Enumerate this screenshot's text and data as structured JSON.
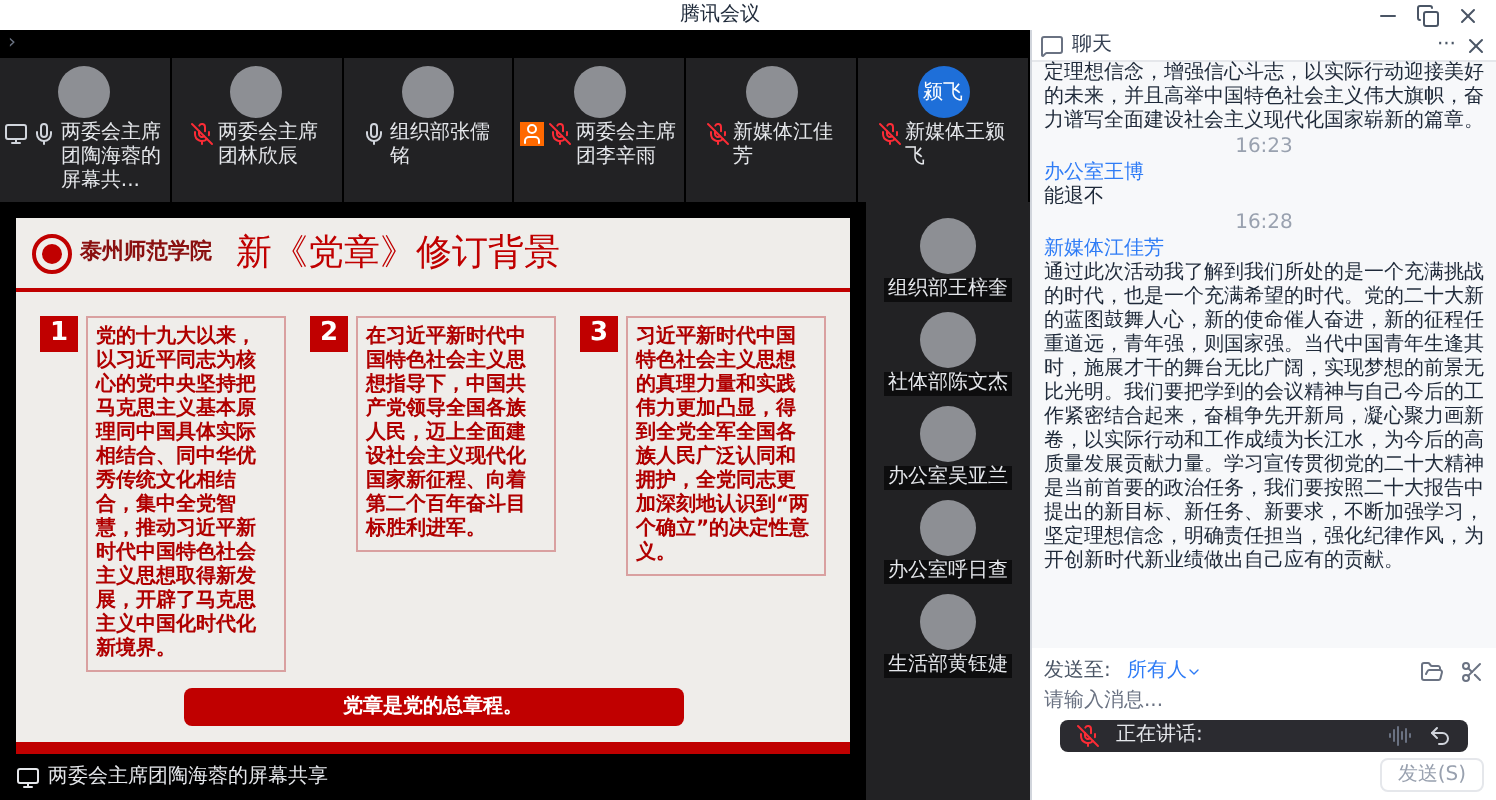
{
  "window": {
    "title": "腾讯会议"
  },
  "top_strip": {
    "toggle": "›",
    "participants": [
      {
        "name": "两委会主席团陶海蓉的屏幕共...",
        "muted": false,
        "sharing": true,
        "host": false
      },
      {
        "name": "两委会主席团林欣辰",
        "muted": true,
        "sharing": false,
        "host": false
      },
      {
        "name": "组织部张儒铭",
        "muted": false,
        "sharing": false,
        "host": false
      },
      {
        "name": "两委会主席团李辛雨",
        "muted": true,
        "sharing": false,
        "host": true
      },
      {
        "name": "新媒体江佳芳",
        "muted": true,
        "sharing": false,
        "host": false
      },
      {
        "name": "新媒体王颍飞",
        "muted": true,
        "sharing": false,
        "host": false,
        "initials": "颍飞"
      }
    ]
  },
  "slide": {
    "school": "泰州师范学院",
    "title": "新《党章》修订背景",
    "cards": [
      {
        "number": "1",
        "text": "党的十九大以来，以习近平同志为核心的党中央坚持把马克思主义基本原理同中国具体实际相结合、同中华优秀传统文化相结合，集中全党智慧，推动习近平新时代中国特色社会主义思想取得新发展，开辟了马克思主义中国化时代化新境界。"
      },
      {
        "number": "2",
        "text": "在习近平新时代中国特色社会主义思想指导下，中国共产党领导全国各族人民，迈上全面建设社会主义现代化国家新征程、向着第二个百年奋斗目标胜利进军。"
      },
      {
        "number": "3",
        "text": "习近平新时代中国特色社会主义思想的真理力量和实践伟力更加凸显，得到全党全军全国各族人民广泛认同和拥护，全党同志更加深刻地认识到“两个确立”的决定性意义。"
      }
    ],
    "banner": "党章是党的总章程。"
  },
  "share_label": "两委会主席团陶海蓉的屏幕共享",
  "side_participants": [
    {
      "name": "组织部王梓奎"
    },
    {
      "name": "社体部陈文杰"
    },
    {
      "name": "办公室吴亚兰"
    },
    {
      "name": "办公室呼日查"
    },
    {
      "name": "生活部黄钰婕"
    }
  ],
  "chat": {
    "title": "聊天",
    "more": "···",
    "messages": [
      {
        "kind": "text",
        "text": "定理想信念，增强信心斗志，以实际行动迎接美好的未来，并且高举中国特色社会主义伟大旗帜，奋力谱写全面建设社会主义现代化国家崭新的篇章。"
      },
      {
        "kind": "time",
        "text": "16:23"
      },
      {
        "kind": "sender",
        "text": "办公室王博"
      },
      {
        "kind": "text",
        "text": "能退不"
      },
      {
        "kind": "time",
        "text": "16:28"
      },
      {
        "kind": "sender",
        "text": "新媒体江佳芳"
      },
      {
        "kind": "text",
        "text": "通过此次活动我了解到我们所处的是一个充满挑战的时代，也是一个充满希望的时代。党的二十大新的蓝图鼓舞人心，新的使命催人奋进，新的征程任重道远，青年强，则国家强。当代中国青年生逢其时，施展才干的舞台无比广阔，实现梦想的前景无比光明。我们要把学到的会议精神与自己今后的工作紧密结合起来，奋楫争先开新局，凝心聚力画新卷，以实际行动和工作成绩为长江水，为今后的高质量发展贡献力量。学习宣传贯彻党的二十大精神是当前首要的政治任务，我们要按照二十大报告中提出的新目标、新任务、新要求，不断加强学习，坚定理想信念，明确责任担当，强化纪律作风，为开创新时代新业绩做出自己应有的贡献。"
      }
    ],
    "send_to_label": "发送至:",
    "recipient": "所有人",
    "placeholder": "请输入消息...",
    "speaking": "正在讲话:",
    "send": "发送(S)"
  }
}
